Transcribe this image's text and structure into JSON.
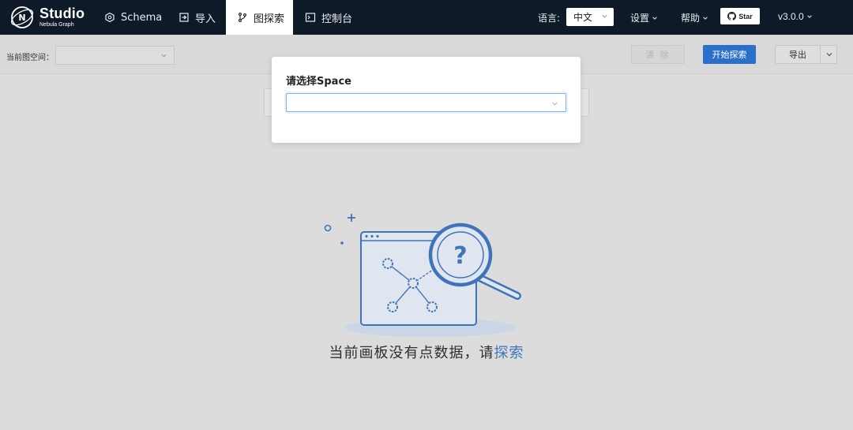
{
  "header": {
    "logo": {
      "title": "Studio",
      "subtitle": "Nebula Graph"
    },
    "nav": [
      {
        "label": "Schema",
        "icon": "hexagon-gear-icon",
        "active": false
      },
      {
        "label": "导入",
        "icon": "import-icon",
        "active": false
      },
      {
        "label": "图探索",
        "icon": "branch-icon",
        "active": true
      },
      {
        "label": "控制台",
        "icon": "terminal-icon",
        "active": false
      }
    ],
    "language_label": "语言:",
    "language_value": "中文",
    "settings_label": "设置",
    "help_label": "帮助",
    "star_label": "Star",
    "version": "v3.0.0"
  },
  "toolbar": {
    "space_label": "当前图空间：",
    "clear_label": "清 除",
    "start_label": "开始探索",
    "export_label": "导出"
  },
  "canvas": {
    "empty_text": "当前画板没有点数据，请",
    "explore_link": "探索"
  },
  "modal": {
    "title": "请选择Space",
    "select_placeholder": ""
  },
  "colors": {
    "header_bg": "#0e1a27",
    "primary": "#2a6fc9",
    "illustration": "#3f74b8"
  }
}
